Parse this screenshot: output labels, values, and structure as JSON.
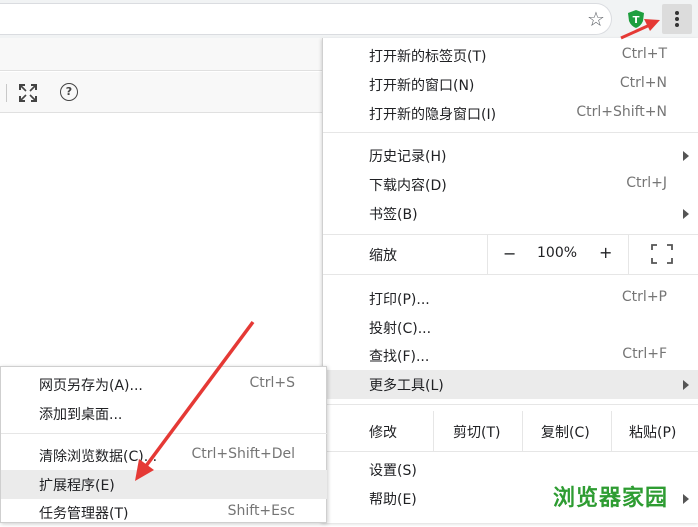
{
  "toolbar": {
    "star_icon": "star-icon",
    "extension_icon": "shield-extension-icon",
    "menu_icon": "kebab-menu-icon"
  },
  "page_toolbar": {
    "help_glyph": "?"
  },
  "menu": {
    "group1": [
      {
        "label": "打开新的标签页(T)",
        "shortcut": "Ctrl+T"
      },
      {
        "label": "打开新的窗口(N)",
        "shortcut": "Ctrl+N"
      },
      {
        "label": "打开新的隐身窗口(I)",
        "shortcut": "Ctrl+Shift+N"
      }
    ],
    "group2": [
      {
        "label": "历史记录(H)",
        "shortcut": ""
      },
      {
        "label": "下载内容(D)",
        "shortcut": "Ctrl+J"
      },
      {
        "label": "书签(B)",
        "shortcut": ""
      }
    ],
    "zoom": {
      "label": "缩放",
      "minus": "−",
      "value": "100%",
      "plus": "+"
    },
    "group3": [
      {
        "label": "打印(P)...",
        "shortcut": "Ctrl+P"
      },
      {
        "label": "投射(C)...",
        "shortcut": ""
      },
      {
        "label": "查找(F)...",
        "shortcut": "Ctrl+F"
      },
      {
        "label": "更多工具(L)",
        "shortcut": ""
      }
    ],
    "edit": {
      "label": "修改",
      "cut": "剪切(T)",
      "copy": "复制(C)",
      "paste": "粘贴(P)"
    },
    "group4": [
      {
        "label": "设置(S)",
        "shortcut": ""
      },
      {
        "label": "帮助(E)",
        "shortcut": ""
      }
    ]
  },
  "submenu": [
    {
      "label": "网页另存为(A)...",
      "shortcut": "Ctrl+S"
    },
    {
      "label": "添加到桌面...",
      "shortcut": ""
    },
    {
      "label": "清除浏览数据(C)...",
      "shortcut": "Ctrl+Shift+Del"
    },
    {
      "label": "扩展程序(E)",
      "shortcut": ""
    },
    {
      "label": "任务管理器(T)",
      "shortcut": "Shift+Esc"
    }
  ],
  "watermark": "浏览器家园",
  "colors": {
    "highlight": "#ebebeb",
    "arrow": "#e53935",
    "watermark": "#2e9c32"
  }
}
